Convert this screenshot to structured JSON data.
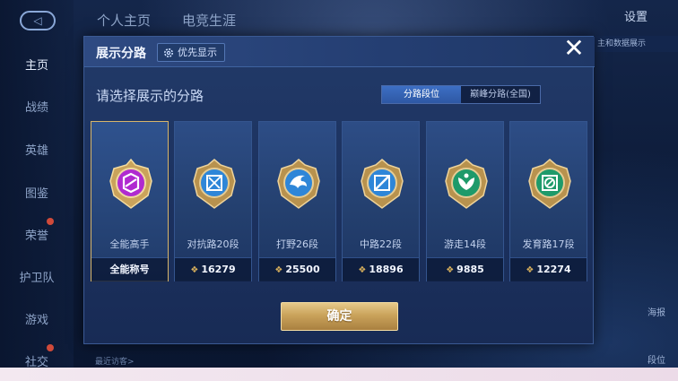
{
  "background": {
    "top_tabs": [
      "个人主页",
      "电竞生涯"
    ],
    "settings_label": "设置",
    "sidebar_items": [
      {
        "label": "主页",
        "active": true
      },
      {
        "label": "战绩",
        "active": false
      },
      {
        "label": "英雄",
        "active": false
      },
      {
        "label": "图鉴",
        "active": false
      },
      {
        "label": "荣誉",
        "active": false
      },
      {
        "label": "护卫队",
        "active": false
      },
      {
        "label": "游戏",
        "active": false
      },
      {
        "label": "社交",
        "active": false
      }
    ],
    "right_chip": "主和数据展示",
    "right_icons": [
      "海报",
      "段位"
    ],
    "recent_text": "最近访客>"
  },
  "dialog": {
    "title": "展示分路",
    "priority_button": "优先显示",
    "close_icon": "close-icon",
    "prompt": "请选择展示的分路",
    "segments": [
      {
        "label": "分路段位",
        "active": true
      },
      {
        "label": "巅峰分路(全国)",
        "active": false
      }
    ],
    "cards": [
      {
        "id": "all",
        "label": "全能高手",
        "footer": "全能称号",
        "selected": true,
        "icon": "all-round-emblem-icon",
        "color": "#b02ad0"
      },
      {
        "id": "clash",
        "label": "对抗路20段",
        "footer": "16279",
        "selected": false,
        "icon": "clash-lane-emblem-icon",
        "color": "#2e86d8"
      },
      {
        "id": "jungle",
        "label": "打野26段",
        "footer": "25500",
        "selected": false,
        "icon": "jungle-emblem-icon",
        "color": "#2e86d8"
      },
      {
        "id": "mid",
        "label": "中路22段",
        "footer": "18896",
        "selected": false,
        "icon": "mid-lane-emblem-icon",
        "color": "#2e86d8"
      },
      {
        "id": "roam",
        "label": "游走14段",
        "footer": "9885",
        "selected": false,
        "icon": "roam-emblem-icon",
        "color": "#1e9a6a"
      },
      {
        "id": "farm",
        "label": "发育路17段",
        "footer": "12274",
        "selected": false,
        "icon": "farm-lane-emblem-icon",
        "color": "#1e9a6a"
      }
    ],
    "confirm_button": "确定"
  },
  "colors": {
    "gold_accent": "#d7b56a",
    "dialog_bg": "#1c3260",
    "segment_active": "#3d6fc4"
  }
}
